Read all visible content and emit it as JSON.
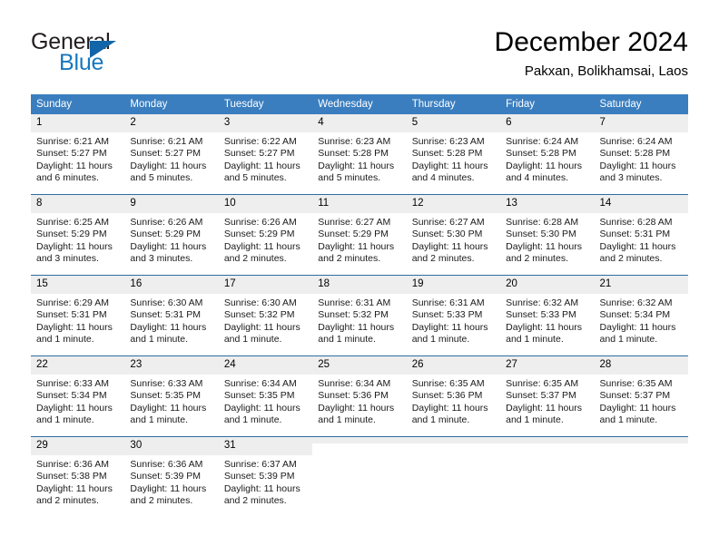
{
  "brand": {
    "word_general": "General",
    "word_blue": "Blue",
    "accent_color": "#1165a8",
    "text_color": "#231f20"
  },
  "header": {
    "title": "December 2024",
    "subtitle": "Pakxan, Bolikhamsai, Laos"
  },
  "theme": {
    "header_row_bg": "#3a7ebf",
    "daynum_bg": "#eeeeee",
    "row_divider": "#2e6da4",
    "page_bg": "#ffffff"
  },
  "weekdays": [
    "Sunday",
    "Monday",
    "Tuesday",
    "Wednesday",
    "Thursday",
    "Friday",
    "Saturday"
  ],
  "weeks": [
    [
      {
        "day": "1",
        "sunrise": "Sunrise: 6:21 AM",
        "sunset": "Sunset: 5:27 PM",
        "daylight": "Daylight: 11 hours and 6 minutes."
      },
      {
        "day": "2",
        "sunrise": "Sunrise: 6:21 AM",
        "sunset": "Sunset: 5:27 PM",
        "daylight": "Daylight: 11 hours and 5 minutes."
      },
      {
        "day": "3",
        "sunrise": "Sunrise: 6:22 AM",
        "sunset": "Sunset: 5:27 PM",
        "daylight": "Daylight: 11 hours and 5 minutes."
      },
      {
        "day": "4",
        "sunrise": "Sunrise: 6:23 AM",
        "sunset": "Sunset: 5:28 PM",
        "daylight": "Daylight: 11 hours and 5 minutes."
      },
      {
        "day": "5",
        "sunrise": "Sunrise: 6:23 AM",
        "sunset": "Sunset: 5:28 PM",
        "daylight": "Daylight: 11 hours and 4 minutes."
      },
      {
        "day": "6",
        "sunrise": "Sunrise: 6:24 AM",
        "sunset": "Sunset: 5:28 PM",
        "daylight": "Daylight: 11 hours and 4 minutes."
      },
      {
        "day": "7",
        "sunrise": "Sunrise: 6:24 AM",
        "sunset": "Sunset: 5:28 PM",
        "daylight": "Daylight: 11 hours and 3 minutes."
      }
    ],
    [
      {
        "day": "8",
        "sunrise": "Sunrise: 6:25 AM",
        "sunset": "Sunset: 5:29 PM",
        "daylight": "Daylight: 11 hours and 3 minutes."
      },
      {
        "day": "9",
        "sunrise": "Sunrise: 6:26 AM",
        "sunset": "Sunset: 5:29 PM",
        "daylight": "Daylight: 11 hours and 3 minutes."
      },
      {
        "day": "10",
        "sunrise": "Sunrise: 6:26 AM",
        "sunset": "Sunset: 5:29 PM",
        "daylight": "Daylight: 11 hours and 2 minutes."
      },
      {
        "day": "11",
        "sunrise": "Sunrise: 6:27 AM",
        "sunset": "Sunset: 5:29 PM",
        "daylight": "Daylight: 11 hours and 2 minutes."
      },
      {
        "day": "12",
        "sunrise": "Sunrise: 6:27 AM",
        "sunset": "Sunset: 5:30 PM",
        "daylight": "Daylight: 11 hours and 2 minutes."
      },
      {
        "day": "13",
        "sunrise": "Sunrise: 6:28 AM",
        "sunset": "Sunset: 5:30 PM",
        "daylight": "Daylight: 11 hours and 2 minutes."
      },
      {
        "day": "14",
        "sunrise": "Sunrise: 6:28 AM",
        "sunset": "Sunset: 5:31 PM",
        "daylight": "Daylight: 11 hours and 2 minutes."
      }
    ],
    [
      {
        "day": "15",
        "sunrise": "Sunrise: 6:29 AM",
        "sunset": "Sunset: 5:31 PM",
        "daylight": "Daylight: 11 hours and 1 minute."
      },
      {
        "day": "16",
        "sunrise": "Sunrise: 6:30 AM",
        "sunset": "Sunset: 5:31 PM",
        "daylight": "Daylight: 11 hours and 1 minute."
      },
      {
        "day": "17",
        "sunrise": "Sunrise: 6:30 AM",
        "sunset": "Sunset: 5:32 PM",
        "daylight": "Daylight: 11 hours and 1 minute."
      },
      {
        "day": "18",
        "sunrise": "Sunrise: 6:31 AM",
        "sunset": "Sunset: 5:32 PM",
        "daylight": "Daylight: 11 hours and 1 minute."
      },
      {
        "day": "19",
        "sunrise": "Sunrise: 6:31 AM",
        "sunset": "Sunset: 5:33 PM",
        "daylight": "Daylight: 11 hours and 1 minute."
      },
      {
        "day": "20",
        "sunrise": "Sunrise: 6:32 AM",
        "sunset": "Sunset: 5:33 PM",
        "daylight": "Daylight: 11 hours and 1 minute."
      },
      {
        "day": "21",
        "sunrise": "Sunrise: 6:32 AM",
        "sunset": "Sunset: 5:34 PM",
        "daylight": "Daylight: 11 hours and 1 minute."
      }
    ],
    [
      {
        "day": "22",
        "sunrise": "Sunrise: 6:33 AM",
        "sunset": "Sunset: 5:34 PM",
        "daylight": "Daylight: 11 hours and 1 minute."
      },
      {
        "day": "23",
        "sunrise": "Sunrise: 6:33 AM",
        "sunset": "Sunset: 5:35 PM",
        "daylight": "Daylight: 11 hours and 1 minute."
      },
      {
        "day": "24",
        "sunrise": "Sunrise: 6:34 AM",
        "sunset": "Sunset: 5:35 PM",
        "daylight": "Daylight: 11 hours and 1 minute."
      },
      {
        "day": "25",
        "sunrise": "Sunrise: 6:34 AM",
        "sunset": "Sunset: 5:36 PM",
        "daylight": "Daylight: 11 hours and 1 minute."
      },
      {
        "day": "26",
        "sunrise": "Sunrise: 6:35 AM",
        "sunset": "Sunset: 5:36 PM",
        "daylight": "Daylight: 11 hours and 1 minute."
      },
      {
        "day": "27",
        "sunrise": "Sunrise: 6:35 AM",
        "sunset": "Sunset: 5:37 PM",
        "daylight": "Daylight: 11 hours and 1 minute."
      },
      {
        "day": "28",
        "sunrise": "Sunrise: 6:35 AM",
        "sunset": "Sunset: 5:37 PM",
        "daylight": "Daylight: 11 hours and 1 minute."
      }
    ],
    [
      {
        "day": "29",
        "sunrise": "Sunrise: 6:36 AM",
        "sunset": "Sunset: 5:38 PM",
        "daylight": "Daylight: 11 hours and 2 minutes."
      },
      {
        "day": "30",
        "sunrise": "Sunrise: 6:36 AM",
        "sunset": "Sunset: 5:39 PM",
        "daylight": "Daylight: 11 hours and 2 minutes."
      },
      {
        "day": "31",
        "sunrise": "Sunrise: 6:37 AM",
        "sunset": "Sunset: 5:39 PM",
        "daylight": "Daylight: 11 hours and 2 minutes."
      },
      {
        "day": "",
        "sunrise": "",
        "sunset": "",
        "daylight": ""
      },
      {
        "day": "",
        "sunrise": "",
        "sunset": "",
        "daylight": ""
      },
      {
        "day": "",
        "sunrise": "",
        "sunset": "",
        "daylight": ""
      },
      {
        "day": "",
        "sunrise": "",
        "sunset": "",
        "daylight": ""
      }
    ]
  ]
}
